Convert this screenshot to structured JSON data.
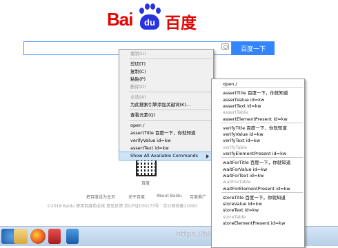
{
  "logo": {
    "text_latin": "Bai",
    "text_paw": "du",
    "text_cn": "百度",
    "colors": {
      "red": "#e10602",
      "blue": "#2932e1"
    }
  },
  "search": {
    "value": "",
    "button_label": "百度一下"
  },
  "qr": {
    "caption": "百度"
  },
  "footer": {
    "links": [
      "把百度设为主页",
      "关于百度",
      "About Baidu",
      "百度推广"
    ],
    "copyright": "©2018 Baidu 使用百度前必读 意见反馈 京ICP证030173号",
    "police": "京公网安备11000"
  },
  "watermark": "https://blog.csdn.net/shu__shu",
  "context_menu": {
    "items": [
      {
        "label": "撤销(U)",
        "disabled": true
      },
      {
        "sep": true
      },
      {
        "label": "剪切(T)",
        "disabled": false
      },
      {
        "label": "复制(C)",
        "disabled": false
      },
      {
        "label": "粘贴(P)",
        "disabled": false
      },
      {
        "label": "删除(D)",
        "disabled": true
      },
      {
        "sep": true
      },
      {
        "label": "全选(A)",
        "disabled": true
      },
      {
        "label": "为此搜索引擎添加关键词(K)...",
        "disabled": false
      },
      {
        "sep": true
      },
      {
        "label": "查看元素(Q)",
        "disabled": false
      },
      {
        "sep": true
      },
      {
        "label": "open /",
        "disabled": false
      },
      {
        "label": "assertTitle 百度一下，你就知道",
        "disabled": false
      },
      {
        "label": "verifyValue id=kw",
        "disabled": false
      },
      {
        "label": "assertText id=kw",
        "disabled": false
      },
      {
        "label": "Show All Available Commands",
        "disabled": false,
        "submenu": true,
        "active": true
      }
    ]
  },
  "submenu": {
    "items": [
      {
        "label": "open /",
        "disabled": false
      },
      {
        "sep": true
      },
      {
        "label": "assertTitle 百度一下，你就知道",
        "disabled": false
      },
      {
        "label": "assertValue id=kw",
        "disabled": false
      },
      {
        "label": "assertText id=kw",
        "disabled": false
      },
      {
        "label": "assertTable",
        "disabled": true
      },
      {
        "label": "assertElementPresent id=kw",
        "disabled": false
      },
      {
        "sep": true
      },
      {
        "label": "verifyTitle 百度一下，你就知道",
        "disabled": false
      },
      {
        "label": "verifyValue id=kw",
        "disabled": false
      },
      {
        "label": "verifyText id=kw",
        "disabled": false
      },
      {
        "label": "verifyTable",
        "disabled": true
      },
      {
        "label": "verifyElementPresent id=kw",
        "disabled": false
      },
      {
        "sep": true
      },
      {
        "label": "waitForTitle 百度一下，你就知道",
        "disabled": false
      },
      {
        "label": "waitForValue id=kw",
        "disabled": false
      },
      {
        "label": "waitForText id=kw",
        "disabled": false
      },
      {
        "label": "waitForTable",
        "disabled": true
      },
      {
        "label": "waitForElementPresent id=kw",
        "disabled": false
      },
      {
        "sep": true
      },
      {
        "label": "storeTitle 百度一下，你就知道",
        "disabled": false
      },
      {
        "label": "storeValue id=kw",
        "disabled": false
      },
      {
        "label": "storeText id=kw",
        "disabled": false
      },
      {
        "label": "storeTable",
        "disabled": true
      },
      {
        "label": "storeElementPresent id=kw",
        "disabled": false
      }
    ]
  },
  "taskbar": {
    "icons": [
      "start-orb-icon",
      "folder-icon",
      "firefox-icon",
      "red-app-icon",
      "blue-app-icon"
    ]
  }
}
